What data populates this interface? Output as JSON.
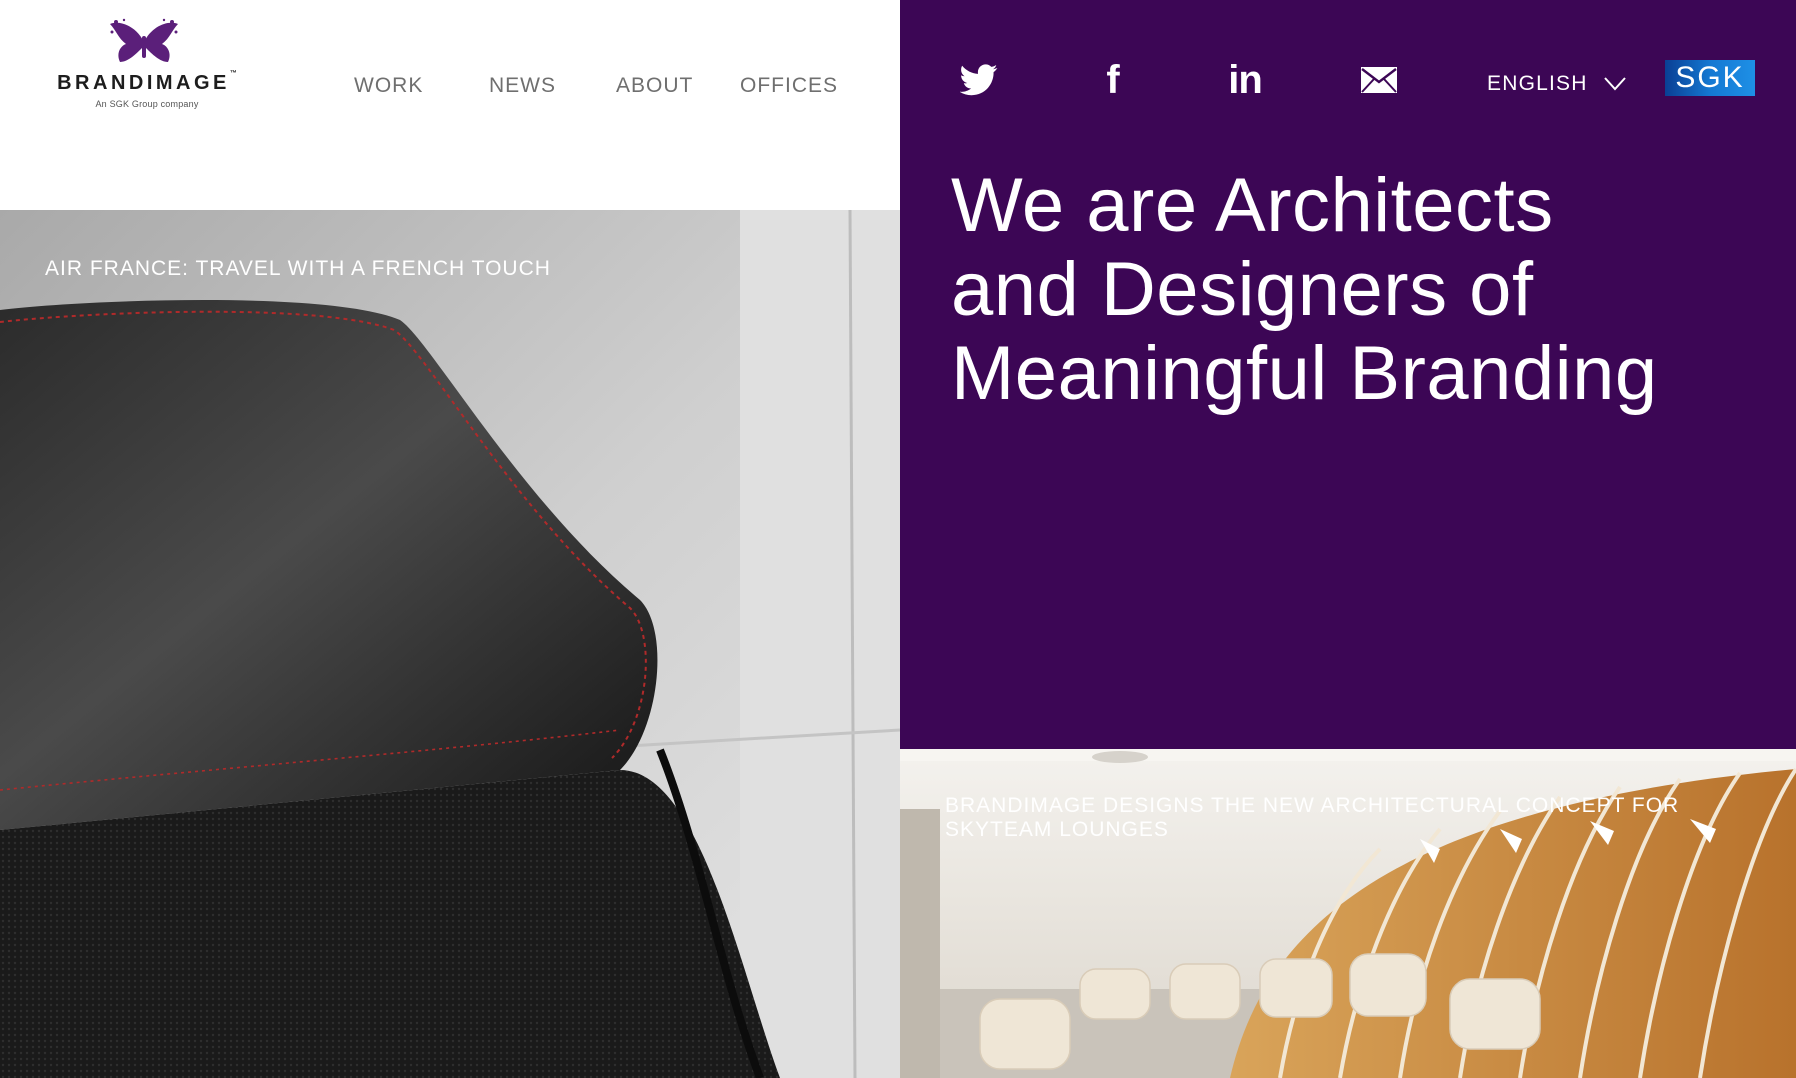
{
  "brand": {
    "name": "BRANDIMAGE",
    "trademark": "™",
    "tagline": "An SGK Group company",
    "accent_color": "#5b1f7a"
  },
  "nav": {
    "items": [
      {
        "label": "WORK"
      },
      {
        "label": "NEWS"
      },
      {
        "label": "ABOUT"
      },
      {
        "label": "OFFICES"
      }
    ]
  },
  "header_right": {
    "background_color": "#3c0655",
    "social": [
      {
        "icon": "twitter-icon"
      },
      {
        "icon": "facebook-icon"
      },
      {
        "icon": "linkedin-icon"
      },
      {
        "icon": "mail-icon"
      }
    ],
    "language": {
      "selected": "ENGLISH",
      "icon": "chevron-down-icon"
    },
    "partner_logo": {
      "text": "SGK"
    }
  },
  "hero": {
    "heading_line1": "We are Architects",
    "heading_line2": "and Designers of",
    "heading_line3": "Meaningful Branding"
  },
  "tiles": [
    {
      "caption": "AIR FRANCE: TRAVEL WITH A FRENCH TOUCH"
    },
    {
      "caption": "BRANDIMAGE DESIGNS THE NEW ARCHITECTURAL CONCEPT FOR SKYTEAM LOUNGES"
    }
  ]
}
